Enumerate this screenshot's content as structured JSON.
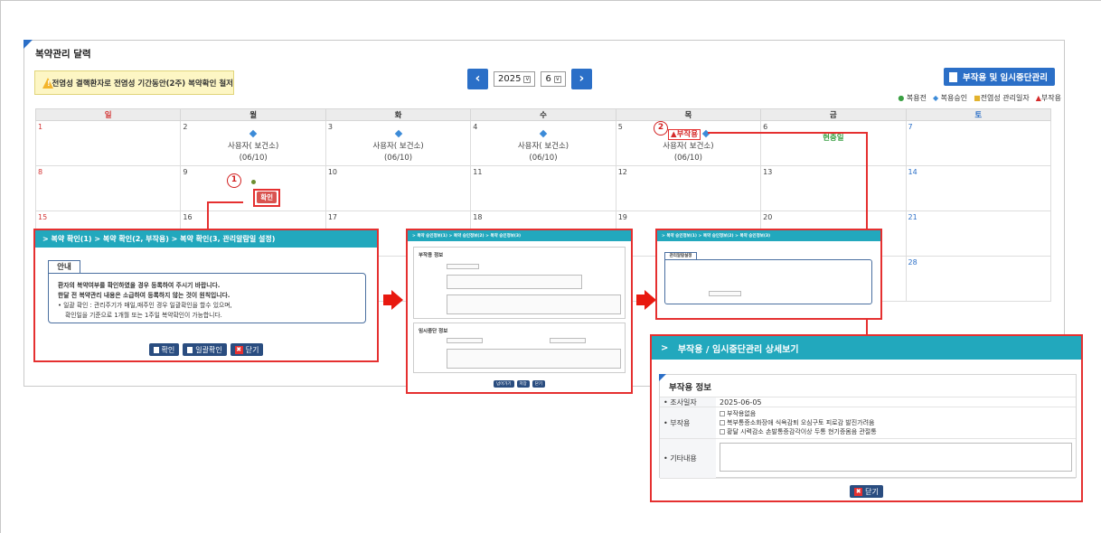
{
  "page": {
    "title": "복약관리 달력"
  },
  "warning": {
    "icon": "warning-icon",
    "text": "전염성 결핵환자로 전염성 기간동안(2주) 복약확인 철저"
  },
  "nav": {
    "year": "2025",
    "month": "6",
    "prev_icon": "chevron-left-icon",
    "next_icon": "chevron-right-icon"
  },
  "side_button": {
    "label": "부작용 및 임시중단관리"
  },
  "legend": {
    "items": [
      {
        "marker": "●",
        "label": "복용전",
        "color": "#3aa043"
      },
      {
        "marker": "◆",
        "label": "복용승인",
        "color": "#3c8bd8"
      },
      {
        "marker": "■",
        "label": "전염성 관리일자",
        "color": "#e2b22d"
      },
      {
        "marker": "▲",
        "label": "부작용",
        "color": "#d52b2b"
      }
    ]
  },
  "calendar": {
    "weekdays": [
      "일",
      "월",
      "화",
      "수",
      "목",
      "금",
      "토"
    ],
    "weeks": [
      [
        {
          "day": "1"
        },
        {
          "day": "2",
          "name": "사용자( 보건소)",
          "date": "(06/10)"
        },
        {
          "day": "3",
          "name": "사용자( 보건소)",
          "date": "(06/10)"
        },
        {
          "day": "4",
          "name": "사용자( 보건소)",
          "date": "(06/10)"
        },
        {
          "day": "5",
          "side": "▲부작용",
          "name": "사용자( 보건소)",
          "date": "(06/10)"
        },
        {
          "day": "6",
          "holiday": "현충일"
        },
        {
          "day": "7"
        }
      ],
      [
        {
          "day": "8"
        },
        {
          "day": "9",
          "tag": "확인"
        },
        {
          "day": "10"
        },
        {
          "day": "11"
        },
        {
          "day": "12"
        },
        {
          "day": "13"
        },
        {
          "day": "14"
        }
      ],
      [
        {
          "day": "15"
        },
        {
          "day": "16"
        },
        {
          "day": "17"
        },
        {
          "day": "18"
        },
        {
          "day": "19"
        },
        {
          "day": "20"
        },
        {
          "day": "21"
        }
      ],
      [
        {
          "day": ""
        },
        {
          "day": ""
        },
        {
          "day": ""
        },
        {
          "day": ""
        },
        {
          "day": ""
        },
        {
          "day": ""
        },
        {
          "day": "28"
        }
      ]
    ]
  },
  "callouts": {
    "one": "1",
    "two": "2"
  },
  "panel1": {
    "breadcrumb": "> 복약 확인(1) > 복약 확인(2, 부작용) > 복약 확인(3, 관리알람일 설정)",
    "tab": "안내",
    "line1": "환자의 복약여부를 확인하였을 경우 등록하여 주시기 바랍니다.",
    "line2": "한달 전 복약관리 내용은 소급하여 등록하지 않는 것이 원칙입니다.",
    "line3": "• 일괄 확인 : 관리주기가 매일,매주인 경우 일괄확인을 할수 있으며,",
    "line4": "확인일을 기준으로 1개월 또는 1주일 복약확인이 가능합니다.",
    "btn_confirm": "확인",
    "btn_bulk": "일괄확인",
    "btn_close": "닫기"
  },
  "panel2": {
    "breadcrumb": "> 복약 승인정보(1) > 복약 승인정보(2) > 복약 승인정보(3)",
    "sec1": "부작용 정보",
    "sec2": "임시중단 정보",
    "btn_prev": "넘어가기",
    "btn_save": "저장",
    "btn_close": "닫기"
  },
  "panel3": {
    "breadcrumb": "> 복약 승인정보(1) > 복약 승인정보(2) > 복약 승인정보(3)",
    "tab": "관리알람설정"
  },
  "panel4": {
    "header": "부작용 / 임시중단관리 상세보기",
    "section": "부작용 정보",
    "rows": {
      "survey_label": "• 조사일자",
      "survey_value": "2025-06-05",
      "side_label": "• 부작용",
      "side_line1": "부작용없음",
      "side_line2": "복부통증소화장애   식욕감퇴   오심구토   피로감   발진가려움",
      "side_line3": "황달   시력감소   손발통증감각이상   두통   현기증몸음   관절통",
      "etc_label": "• 기타내용"
    },
    "btn_close": "닫기"
  }
}
